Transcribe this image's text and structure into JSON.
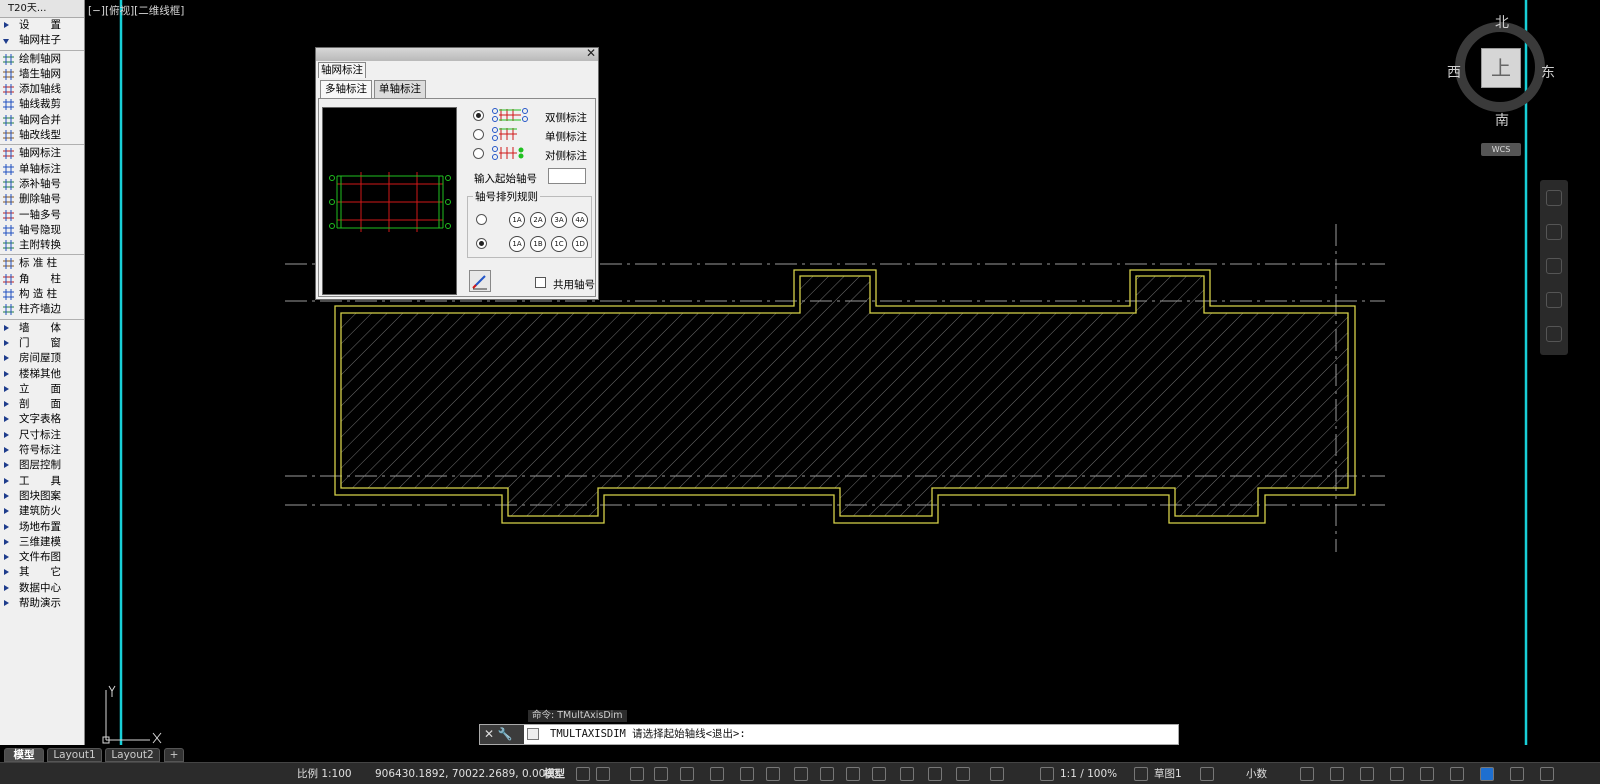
{
  "app": {
    "panel_title": "T20天..."
  },
  "sidebar": {
    "items": [
      {
        "label": "设　　置",
        "kind": "cat"
      },
      {
        "label": "轴网柱子",
        "kind": "open"
      },
      {
        "label": "绘制轴网",
        "kind": "tool"
      },
      {
        "label": "墙生轴网",
        "kind": "tool"
      },
      {
        "label": "添加轴线",
        "kind": "tool"
      },
      {
        "label": "轴线裁剪",
        "kind": "tool"
      },
      {
        "label": "轴网合并",
        "kind": "tool"
      },
      {
        "label": "轴改线型",
        "kind": "tool"
      },
      {
        "label": "轴网标注",
        "kind": "tool"
      },
      {
        "label": "单轴标注",
        "kind": "tool"
      },
      {
        "label": "添补轴号",
        "kind": "tool"
      },
      {
        "label": "删除轴号",
        "kind": "tool"
      },
      {
        "label": "一轴多号",
        "kind": "tool"
      },
      {
        "label": "轴号隐现",
        "kind": "tool"
      },
      {
        "label": "主附转换",
        "kind": "tool"
      },
      {
        "label": "标 准 柱",
        "kind": "tool"
      },
      {
        "label": "角　　柱",
        "kind": "tool"
      },
      {
        "label": "构 造 柱",
        "kind": "tool"
      },
      {
        "label": "柱齐墙边",
        "kind": "tool"
      },
      {
        "label": "墙　　体",
        "kind": "cat"
      },
      {
        "label": "门　　窗",
        "kind": "cat"
      },
      {
        "label": "房间屋顶",
        "kind": "cat"
      },
      {
        "label": "楼梯其他",
        "kind": "cat"
      },
      {
        "label": "立　　面",
        "kind": "cat"
      },
      {
        "label": "剖　　面",
        "kind": "cat"
      },
      {
        "label": "文字表格",
        "kind": "cat"
      },
      {
        "label": "尺寸标注",
        "kind": "cat"
      },
      {
        "label": "符号标注",
        "kind": "cat"
      },
      {
        "label": "图层控制",
        "kind": "cat"
      },
      {
        "label": "工　　具",
        "kind": "cat"
      },
      {
        "label": "图块图案",
        "kind": "cat"
      },
      {
        "label": "建筑防火",
        "kind": "cat"
      },
      {
        "label": "场地布置",
        "kind": "cat"
      },
      {
        "label": "三维建模",
        "kind": "cat"
      },
      {
        "label": "文件布图",
        "kind": "cat"
      },
      {
        "label": "其　　它",
        "kind": "cat"
      },
      {
        "label": "数据中心",
        "kind": "cat"
      },
      {
        "label": "帮助演示",
        "kind": "cat"
      }
    ]
  },
  "viewport": {
    "label": "[−][俯视][二维线框]",
    "ucs_x": "X",
    "ucs_y": "Y"
  },
  "viewcube": {
    "north": "北",
    "south": "南",
    "east": "东",
    "west": "西",
    "face": "上",
    "wcs": "WCS"
  },
  "dialog": {
    "window_title": "轴网标注",
    "tabs": [
      {
        "label": "多轴标注",
        "active": true
      },
      {
        "label": "单轴标注",
        "active": false
      }
    ],
    "options": [
      {
        "label": "双侧标注",
        "selected": true
      },
      {
        "label": "单侧标注",
        "selected": false
      },
      {
        "label": "对侧标注",
        "selected": false
      }
    ],
    "start_axis_label": "输入起始轴号",
    "start_axis_value": "",
    "rule_group": "轴号排列规则",
    "rule_rows": [
      {
        "selected": false,
        "bubbles": [
          "1A",
          "2A",
          "3A",
          "4A"
        ]
      },
      {
        "selected": true,
        "bubbles": [
          "1A",
          "1B",
          "1C",
          "1D"
        ]
      }
    ],
    "shared_axis_label": "共用轴号",
    "shared_axis_checked": false
  },
  "command": {
    "tooltip": "命令: TMultAxisDim",
    "line": "TMULTAXISDIM 请选择起始轴线<退出>:"
  },
  "layout_tabs": [
    {
      "label": "模型",
      "active": true
    },
    {
      "label": "Layout1",
      "active": false
    },
    {
      "label": "Layout2",
      "active": false
    },
    {
      "label": "+",
      "active": false
    }
  ],
  "status": {
    "scale": "比例 1:100",
    "coords": "906430.1892, 70022.2689, 0.0000",
    "space": "模型",
    "annotation_scale": "1:1 / 100%",
    "workspace": "草图1",
    "units": "小数"
  },
  "colors": {
    "viewport_bg": "#000000",
    "wall_outline": "#d6d24a",
    "axis_line": "#9a9a9a",
    "viewport_border": "#18d0d8",
    "preview_axis": "#d01818",
    "preview_dim": "#20c020"
  }
}
